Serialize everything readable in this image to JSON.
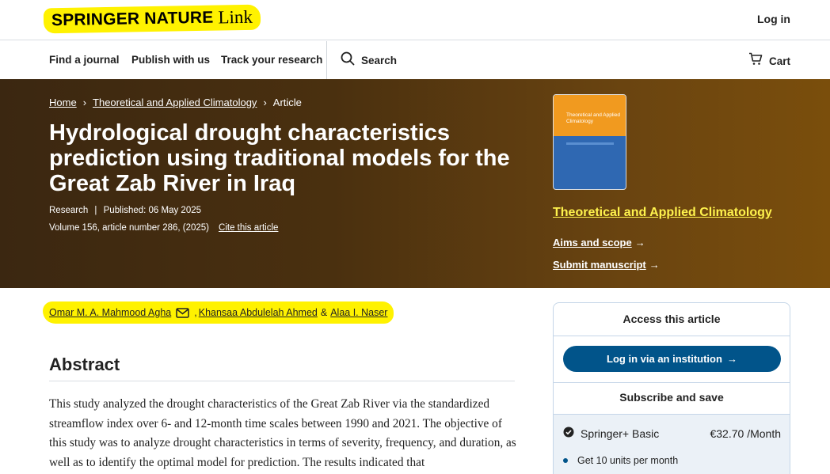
{
  "brand": {
    "name": "SPRINGER NATURE",
    "suffix": "Link"
  },
  "header": {
    "login": "Log in"
  },
  "nav": {
    "items": [
      "Find a journal",
      "Publish with us",
      "Track your research"
    ],
    "search": "Search",
    "cart": "Cart"
  },
  "breadcrumb": {
    "home": "Home",
    "journal": "Theoretical and Applied Climatology",
    "current": "Article",
    "sep": "›"
  },
  "article": {
    "title": "Hydrological drought characteristics prediction using traditional models for the Great Zab River in Iraq",
    "type": "Research",
    "meta_sep": "|",
    "published": "Published: 06 May 2025",
    "volume": "Volume 156, article number 286, (2025)",
    "cite": "Cite this article"
  },
  "authors": {
    "a1": "Omar M. A. Mahmood Agha",
    "sep1": ",",
    "a2": "Khansaa Abdulelah Ahmed",
    "sep2": "&",
    "a3": "Alaa I. Naser"
  },
  "journal_sidebar": {
    "cover_title": "Theoretical and Applied Climatology",
    "journal_name": "Theoretical and Applied Climatology",
    "aims": "Aims and scope",
    "submit": "Submit manuscript",
    "arrow": "→"
  },
  "abstract": {
    "heading": "Abstract",
    "text": "This study analyzed the drought characteristics of the Great Zab River via the standardized streamflow index over 6- and 12-month time scales between 1990 and 2021. The objective of this study was to analyze drought characteristics in terms of severity, frequency, and duration, as well as to identify the optimal model for prediction. The results indicated that"
  },
  "access": {
    "title": "Access this article",
    "login_btn": "Log in via an institution",
    "arrow": "→",
    "subscribe": "Subscribe and save",
    "plan_name": "Springer+ Basic",
    "plan_price": "€32.70 /Month",
    "bullet1": "Get 10 units per month"
  },
  "colors": {
    "accent": "#01548a",
    "highlight": "#fff200",
    "hero": "#4a300f"
  }
}
